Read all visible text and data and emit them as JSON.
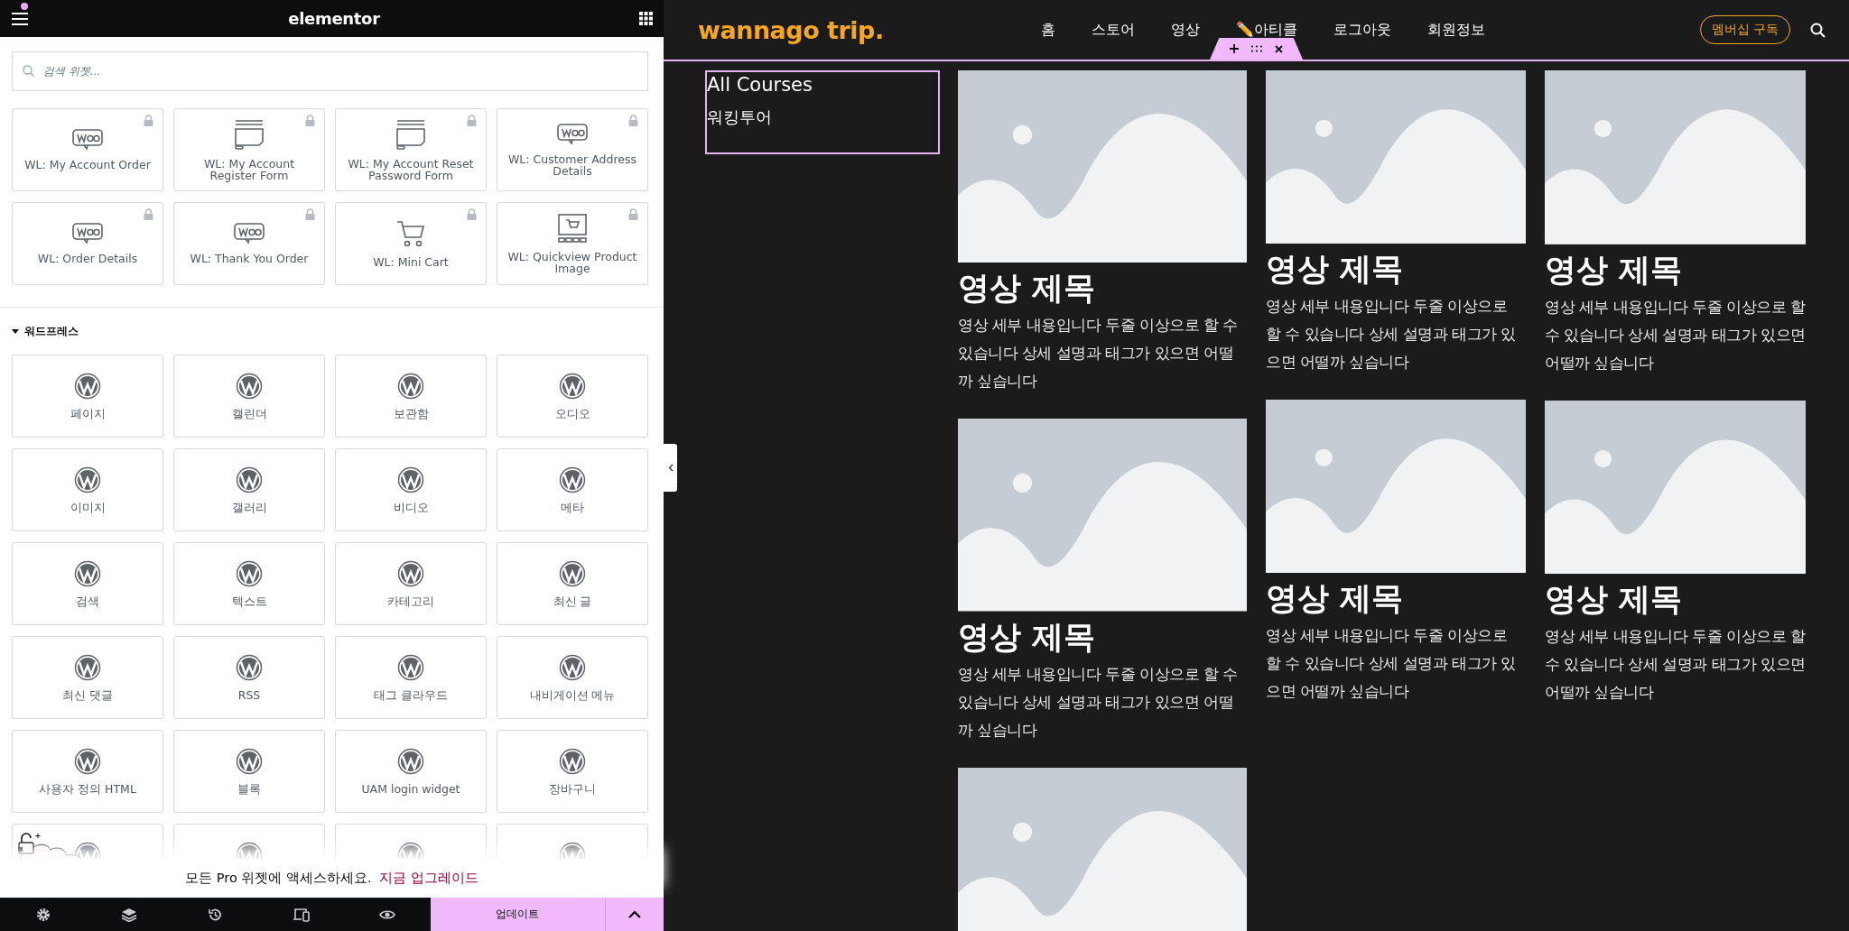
{
  "editor": {
    "brand": "elementor",
    "search": {
      "placeholder": "검색 위젯..."
    },
    "pro_widgets": [
      {
        "label": "WL: My Account Order",
        "kind": "woo",
        "locked": true
      },
      {
        "label": "WL: My Account Register Form",
        "kind": "form",
        "locked": true
      },
      {
        "label": "WL: My Account Reset Password Form",
        "kind": "form",
        "locked": true
      },
      {
        "label": "WL: Customer Address Details",
        "kind": "woo",
        "locked": true
      },
      {
        "label": "WL: Order Details",
        "kind": "woo",
        "locked": true
      },
      {
        "label": "WL: Thank You Order",
        "kind": "woo",
        "locked": true
      },
      {
        "label": "WL: Mini Cart",
        "kind": "cart",
        "locked": true
      },
      {
        "label": "WL: Quickview Product Image",
        "kind": "quickview",
        "locked": true
      }
    ],
    "section": {
      "title": "워드프레스",
      "expanded": true
    },
    "wp_widgets": [
      {
        "label": "페이지"
      },
      {
        "label": "캘린더"
      },
      {
        "label": "보관함"
      },
      {
        "label": "오디오"
      },
      {
        "label": "이미지"
      },
      {
        "label": "갤러리"
      },
      {
        "label": "비디오"
      },
      {
        "label": "메타"
      },
      {
        "label": "검색"
      },
      {
        "label": "텍스트"
      },
      {
        "label": "카테고리"
      },
      {
        "label": "최신 글"
      },
      {
        "label": "최신 댓글"
      },
      {
        "label": "RSS"
      },
      {
        "label": "태그 클라우드"
      },
      {
        "label": "내비게이션 메뉴"
      },
      {
        "label": "사용자 정의 HTML"
      },
      {
        "label": "블록"
      },
      {
        "label": "UAM login widget"
      },
      {
        "label": "장바구니"
      },
      {
        "kind": "icon_only"
      },
      {
        "kind": "icon_only"
      },
      {
        "kind": "icon_only"
      },
      {
        "kind": "icon_only"
      }
    ],
    "upgrade": {
      "text": "모든 Pro 위젯에 액세스하세요.",
      "link": "지금 업그레이드"
    },
    "footer": {
      "update_button": "업데이트"
    }
  },
  "site": {
    "logo": "wannago trip.",
    "nav": [
      {
        "label": "홈"
      },
      {
        "label": "스토어"
      },
      {
        "label": "영상"
      },
      {
        "label": "✏️아티클"
      },
      {
        "label": "로그아웃"
      },
      {
        "label": "회원정보"
      }
    ],
    "membership_button": "멤버십 구독",
    "sidebar": [
      "All Courses",
      "워킹투어"
    ],
    "columns": [
      {
        "cards": [
          {
            "kind": "full",
            "title": "영상 제목",
            "description": "영상 세부 내용입니다 두줄 이상으로 할 수 있습니다 상세 설명과 태그가 있으면 어떨까 싶습니다"
          },
          {
            "kind": "full",
            "title": "영상 제목",
            "description": "영상 세부 내용입니다 두줄 이상으로 할 수 있습니다 상세 설명과 태그가 있으면 어떨까 싶습니다"
          },
          {
            "kind": "image_only"
          }
        ]
      },
      {
        "cards": [
          {
            "kind": "full",
            "title": "영상 제목",
            "description": "영상 세부 내용입니다 두줄 이상으로 할 수 있습니다 상세 설명과 태그가 있으면 어떨까 싶습니다"
          },
          {
            "kind": "full",
            "title": "영상 제목",
            "description": "영상 세부 내용입니다 두줄 이상으로 할 수 있습니다 상세 설명과 태그가 있으면 어떨까 싶습니다"
          }
        ]
      },
      {
        "cards": [
          {
            "kind": "full",
            "title": "영상 제목",
            "description": "영상 세부 내용입니다 두줄 이상으로 할 수 있습니다 상세 설명과 태그가 있으면 어떨까 싶습니다"
          },
          {
            "kind": "full",
            "title": "영상 제목",
            "description": "영상 세부 내용입니다 두줄 이상으로 할 수 있습니다 상세 설명과 태그가 있으면 어떨까 싶습니다"
          }
        ]
      }
    ]
  }
}
